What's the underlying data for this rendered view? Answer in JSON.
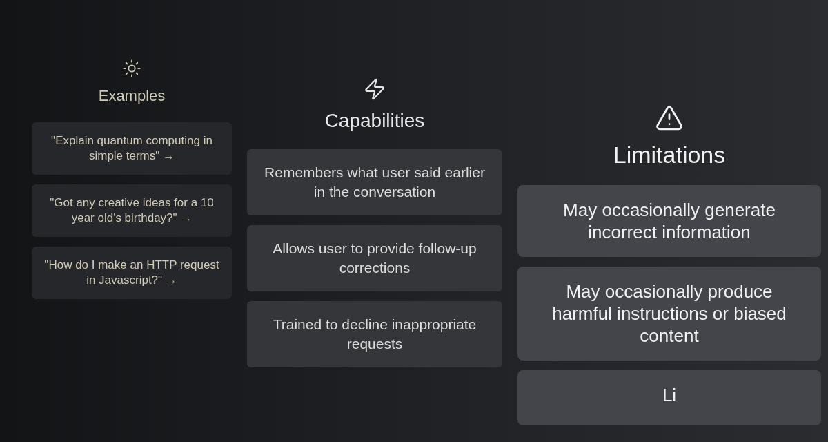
{
  "columns": [
    {
      "kind": "examples",
      "title": "Examples",
      "items": [
        {
          "text": "\"Explain quantum computing in simple terms\" →"
        },
        {
          "text": "\"Got any creative ideas for a 10 year old's birthday?\" →"
        },
        {
          "text": "\"How do I make an HTTP request in Javascript?\" →"
        }
      ]
    },
    {
      "kind": "capabilities",
      "title": "Capabilities",
      "items": [
        {
          "text": "Remembers what user said earlier in the conversation"
        },
        {
          "text": "Allows user to provide follow-up corrections"
        },
        {
          "text": "Trained to decline inappropriate requests"
        }
      ]
    },
    {
      "kind": "limitations",
      "title": "Limitations",
      "items": [
        {
          "text": "May occasionally generate incorrect information"
        },
        {
          "text": "May occasionally produce harmful instructions or biased content"
        },
        {
          "text": "Li"
        }
      ]
    }
  ]
}
